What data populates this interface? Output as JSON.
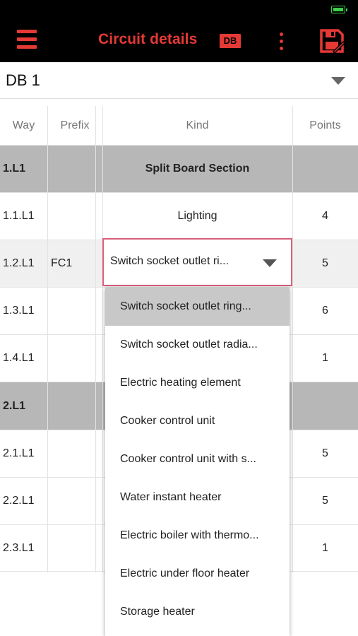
{
  "appbar": {
    "title": "Circuit details",
    "badge": "DB",
    "icons": [
      "menu-icon",
      "more-vert-icon",
      "save-icon",
      "battery-icon"
    ],
    "accent_color": "#e53935"
  },
  "db_select": {
    "value": "DB 1"
  },
  "table": {
    "headers": [
      "Way",
      "Prefix",
      "Kind",
      "Points"
    ],
    "rows": [
      {
        "way": "1.L1",
        "prefix": "",
        "kind": "Split Board Section",
        "points": "",
        "type": "section"
      },
      {
        "way": "1.1.L1",
        "prefix": "",
        "kind": "Lighting",
        "points": "4",
        "type": "normal"
      },
      {
        "way": "1.2.L1",
        "prefix": "FC1",
        "kind": "Switch socket outlet ri...",
        "points": "5",
        "type": "alt"
      },
      {
        "way": "1.3.L1",
        "prefix": "",
        "kind": "",
        "points": "6",
        "type": "normal"
      },
      {
        "way": "1.4.L1",
        "prefix": "",
        "kind": "",
        "points": "1",
        "type": "normal"
      },
      {
        "way": "2.L1",
        "prefix": "",
        "kind": "",
        "points": "",
        "type": "section"
      },
      {
        "way": "2.1.L1",
        "prefix": "",
        "kind": "",
        "points": "5",
        "type": "normal"
      },
      {
        "way": "2.2.L1",
        "prefix": "",
        "kind": "",
        "points": "5",
        "type": "normal"
      },
      {
        "way": "2.3.L1",
        "prefix": "",
        "kind": "",
        "points": "1",
        "type": "normal"
      }
    ]
  },
  "kind_dropdown": {
    "selected_value": "Switch socket outlet ri...",
    "options": [
      "Switch socket outlet ring...",
      "Switch socket outlet radia...",
      "Electric heating element",
      "Cooker control unit",
      "Cooker control unit with s...",
      "Water instant heater",
      "Electric boiler with thermo...",
      "Electric under floor heater",
      "Storage heater"
    ],
    "highlighted_index": 0
  }
}
